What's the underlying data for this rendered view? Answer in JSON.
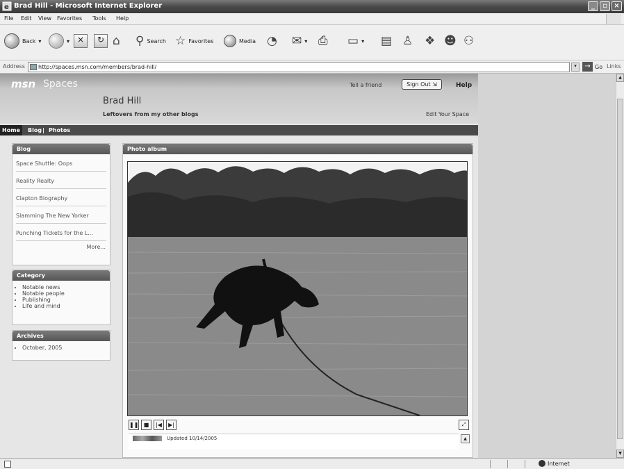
{
  "window": {
    "title": "Brad Hill - Microsoft Internet Explorer",
    "controls": [
      "minimize",
      "maximize",
      "close"
    ]
  },
  "menu": [
    "File",
    "Edit",
    "View",
    "Favorites",
    "Tools",
    "Help"
  ],
  "toolbar": {
    "back": "Back",
    "search": "Search",
    "favorites": "Favorites",
    "media": "Media",
    "icons": [
      "back-icon",
      "forward-icon",
      "stop-icon",
      "refresh-icon",
      "home-icon",
      "search-icon",
      "favorites-star-icon",
      "media-icon",
      "history-icon",
      "mail-icon",
      "print-icon",
      "edit-icon",
      "discuss-icon",
      "messenger-icon",
      "research-icon",
      "messenger-buddy-icon"
    ]
  },
  "address": {
    "label": "Address",
    "url": "http://spaces.msn.com/members/brad-hill/",
    "go": "Go",
    "links": "Links"
  },
  "space": {
    "logo": "msn",
    "product": "Spaces",
    "tell_friend": "Tell a friend",
    "sign_out": "Sign Out",
    "help": "Help",
    "title": "Brad Hill",
    "subtitle": "Leftovers from my other blogs",
    "edit": "Edit Your Space",
    "nav": {
      "home": "Home",
      "blog": "Blog",
      "sep": "|",
      "photos": "Photos"
    }
  },
  "blog_module": {
    "title": "Blog",
    "items": [
      "Space Shuttle: Oops",
      "Reality Realty",
      "Clapton Biography",
      "Slamming The New Yorker",
      "Punching Tickets for the L..."
    ],
    "more": "More..."
  },
  "category_module": {
    "title": "Category",
    "items": [
      "Notable news",
      "Notable people",
      "Publishing",
      "Life and mind"
    ]
  },
  "archives_module": {
    "title": "Archives",
    "items": [
      "October, 2005"
    ]
  },
  "photo_module": {
    "title": "Photo album",
    "image_subject": "black dog leaping over lake with trees",
    "updated": "Updated 10/14/2005",
    "controls": [
      "pause",
      "stop",
      "previous",
      "next"
    ]
  },
  "status": {
    "zone": "Internet"
  }
}
